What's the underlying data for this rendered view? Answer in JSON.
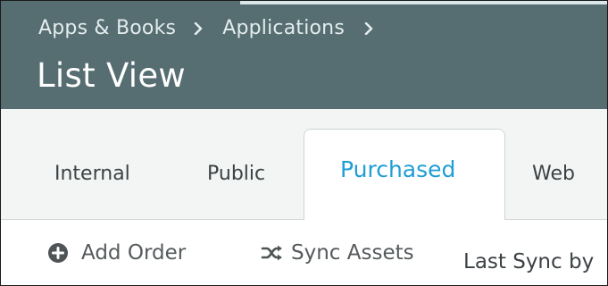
{
  "header": {
    "breadcrumb": [
      {
        "label": "Apps & Books"
      },
      {
        "label": "Applications"
      }
    ],
    "title": "List View"
  },
  "tabs": [
    {
      "label": "Internal",
      "active": false
    },
    {
      "label": "Public",
      "active": false
    },
    {
      "label": "Purchased",
      "active": true
    },
    {
      "label": "Web",
      "active": false
    }
  ],
  "toolbar": {
    "add_order_label": "Add Order",
    "sync_assets_label": "Sync Assets",
    "last_sync_text": "Last Sync by"
  },
  "colors": {
    "header_bg": "#566d71",
    "active_tab_text": "#1f9ed4",
    "tabs_band_bg": "#f3f5f5"
  },
  "icons": {
    "add_order": "plus-circle-icon",
    "sync_assets": "shuffle-icon",
    "breadcrumb_separator": "chevron-right-icon"
  }
}
